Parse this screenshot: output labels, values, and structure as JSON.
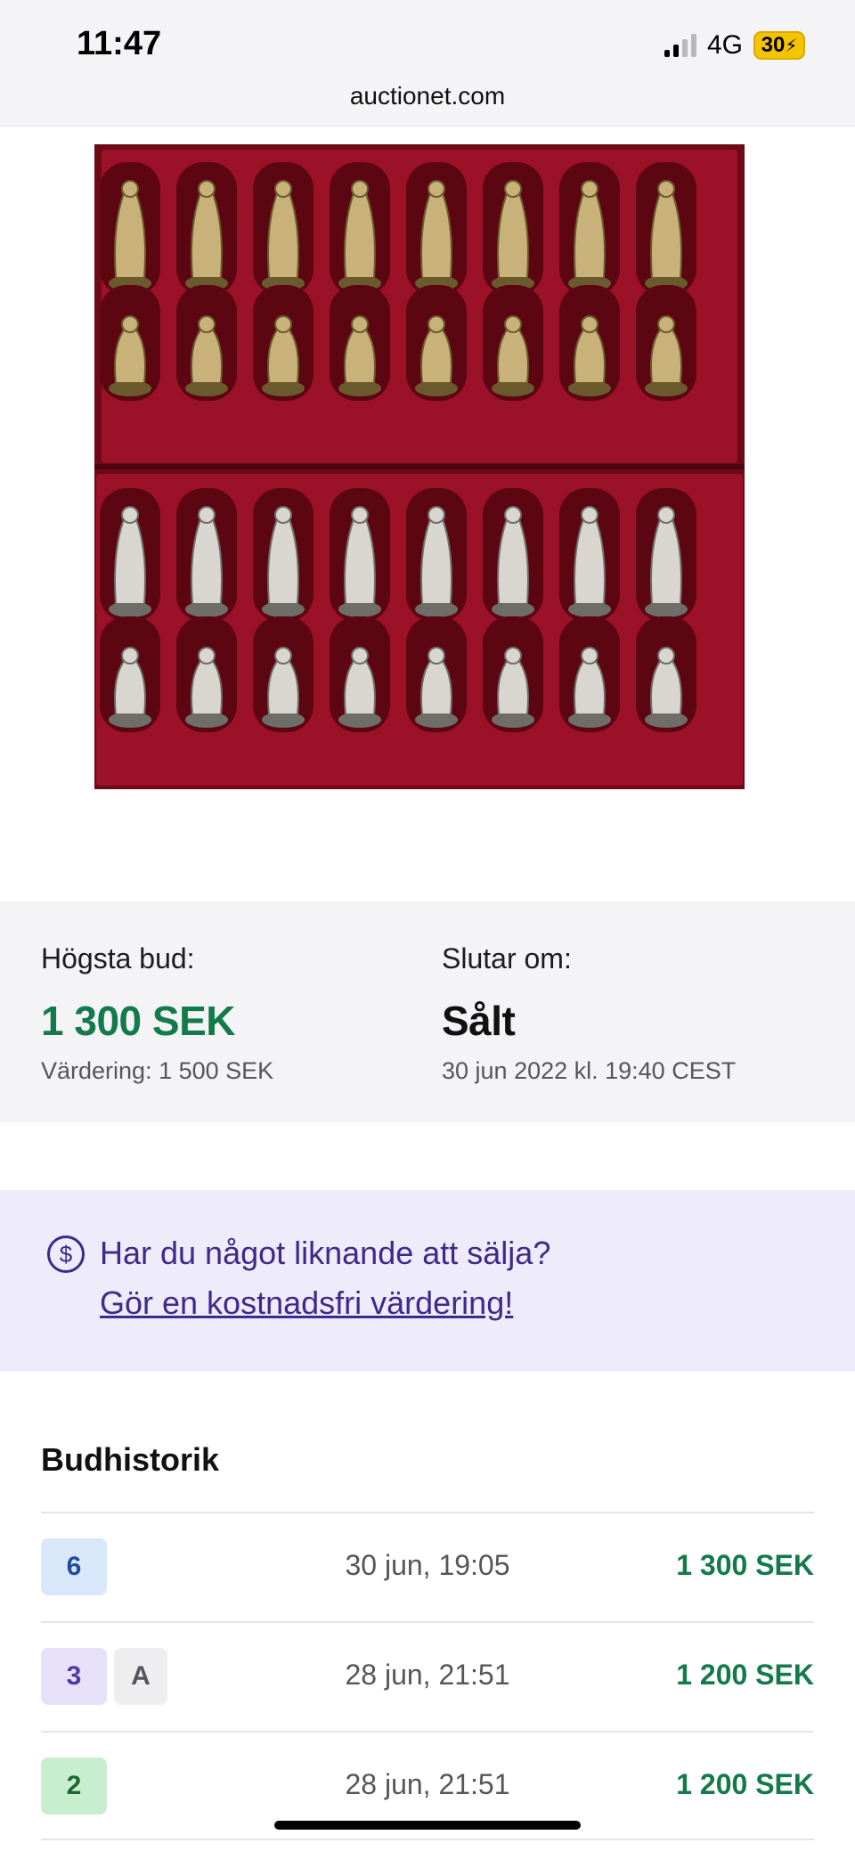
{
  "status_bar": {
    "time": "11:47",
    "network": "4G",
    "battery": "30"
  },
  "browser": {
    "url": "auctionet.com"
  },
  "gallery": {
    "image_subject": "chess-set-icon",
    "dots_count": 4,
    "active_dot": 2
  },
  "summary": {
    "highest_bid_label": "Högsta bud:",
    "highest_bid_value": "1 300 SEK",
    "valuation": "Värdering: 1 500 SEK",
    "ends_label": "Slutar om:",
    "ends_value": "Sålt",
    "ends_date": "30 jun 2022 kl. 19:40 CEST"
  },
  "sell_promo": {
    "icon": "dollar-circle-icon",
    "question": "Har du något liknande att sälja?",
    "link": "Gör en kostnadsfri värdering!"
  },
  "history": {
    "title": "Budhistorik",
    "rows": [
      {
        "bidder": "6",
        "badge_color": "#d9e7fb",
        "extra": "",
        "time": "30 jun, 19:05",
        "amount": "1 300 SEK"
      },
      {
        "bidder": "3",
        "badge_color": "#e6e1f8",
        "extra": "A",
        "time": "28 jun, 21:51",
        "amount": "1 200 SEK"
      },
      {
        "bidder": "2",
        "badge_color": "#c7efcd",
        "extra": "",
        "time": "28 jun, 21:51",
        "amount": "1 200 SEK"
      }
    ]
  },
  "colors": {
    "price_green": "#137a4a",
    "promo_purple": "#3d2a8a",
    "promo_bg": "#eeecfb",
    "velvet_red": "#8c0c1e"
  }
}
